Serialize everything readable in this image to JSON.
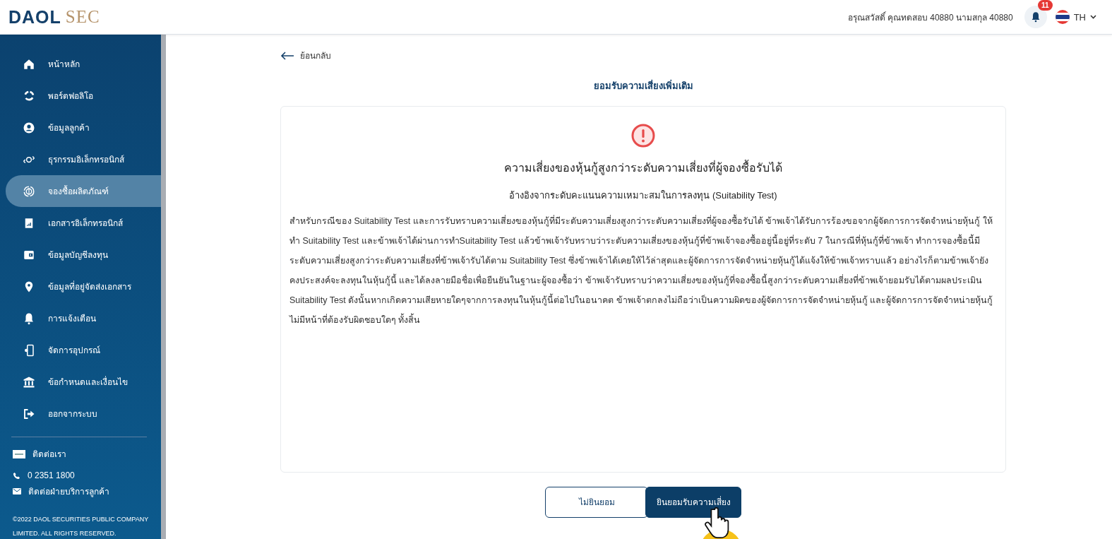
{
  "header": {
    "logo": {
      "primary": "DAOL",
      "secondary": "SEC"
    },
    "greeting": "อรุณสวัสดิ์ คุณทดสอบ 40880 นามสกุล 40880",
    "notification_count": "11",
    "language": "TH"
  },
  "sidebar": {
    "items": [
      {
        "label": "หน้าหลัก",
        "kind": "home",
        "selected": false
      },
      {
        "label": "พอร์ตฟอลิโอ",
        "kind": "portfolio",
        "selected": false
      },
      {
        "label": "ข้อมูลลูกค้า",
        "kind": "user",
        "selected": false
      },
      {
        "label": "ธุรกรรมอิเล็กทรอนิกส์",
        "kind": "exchange",
        "selected": false
      },
      {
        "label": "จองซื้อผลิตภัณฑ์",
        "kind": "coin",
        "selected": true
      },
      {
        "label": "เอกสารอิเล็กทรอนิกส์",
        "kind": "document",
        "selected": false
      },
      {
        "label": "ข้อมูลบัญชีลงทุน",
        "kind": "wallet",
        "selected": false
      },
      {
        "label": "ข้อมูลที่อยู่จัดส่งเอกสาร",
        "kind": "pin",
        "selected": false
      },
      {
        "label": "การแจ้งเตือน",
        "kind": "bell",
        "selected": false
      },
      {
        "label": "จัดการอุปกรณ์",
        "kind": "device",
        "selected": false
      },
      {
        "label": "ข้อกำหนดและเงื่อนไข",
        "kind": "bank",
        "selected": false
      },
      {
        "label": "ออกจากระบบ",
        "kind": "logout",
        "selected": false
      }
    ],
    "contact": {
      "title": "ติดต่อเรา",
      "phone": "0 2351 1800",
      "email_label": "ติดต่อฝ่ายบริการลูกค้า"
    },
    "copyright": [
      "©2022 DAOL SECURITIES PUBLIC COMPANY",
      "LIMITED. ALL RIGHTS RESERVED."
    ]
  },
  "page": {
    "back_label": "ย้อนกลับ",
    "title": "ยอมรับความเสี่ยงเพิ่มเติม",
    "card": {
      "heading": "ความเสี่ยงของหุ้นกู้สูงกว่าระดับความเสี่ยงที่ผู้จองซื้อรับได้",
      "subheading": "อ้างอิงจากระดับคะแนนความเหมาะสมในการลงทุน (Suitability Test)",
      "body": "สำหรับกรณีของ Suitability Test และการรับทราบความเสี่ยงของหุ้นกู้ที่มีระดับความเสี่ยงสูงกว่าระดับความเสี่ยงที่ผู้จองซื้อรับได้ ข้าพเจ้าได้รับการร้องขอจากผู้จัดการการจัดจำหน่ายหุ้นกู้ ให้ทำ Suitability Test และข้าพเจ้าได้ผ่านการทำSuitability Test แล้วข้าพเจ้ารับทราบว่าระดับความเสี่ยงของหุ้นกู้ที่ข้าพเจ้าจองซื้ออยู่นี้อยู่ที่ระดับ 7 ในกรณีที่หุ้นกู้ที่ข้าพเจ้า ทำการจองซื้อนี้มีระดับความเสี่ยงสูงกว่าระดับความเสี่ยงที่ข้าพเจ้ารับได้ตาม Suitability Test ซึ่งข้าพเจ้าได้เคยให้ไว้ล่าสุดและผู้จัดการการจัดจำหน่ายหุ้นกู้ได้แจ้งให้ข้าพเจ้าทราบแล้ว อย่างไรก็ตามข้าพเจ้ายังคงประสงค์จะลงทุนในหุ้นกู้นี้ และได้ลงลายมือชื่อเพื่อยืนยันในฐานะผู้จองซื้อว่า ข้าพเจ้ารับทราบว่าความเสี่ยงของหุ้นกู้ที่จองซื้อนี้สูงกว่าระดับความเสี่ยงที่ข้าพเจ้ายอมรับได้ตามผลประเมิน Suitability Test ดังนั้นหากเกิดความเสียหายใดๆจากการลงทุนในหุ้นกู้นี้ต่อไปในอนาคต ข้าพเจ้าตกลงไม่ถือว่าเป็นความผิดของผู้จัดการการจัดจำหน่ายหุ้นกู้ และผู้จัดการการจัดจำหน่ายหุ้นกู้ไม่มีหน้าที่ต้องรับผิดชอบใดๆ ทั้งสิ้น"
    },
    "buttons": [
      {
        "label": "ไม่ยินยอม",
        "kind": "secondary"
      },
      {
        "label": "ยินยอมรับความเสี่ยง",
        "kind": "primary"
      }
    ]
  }
}
